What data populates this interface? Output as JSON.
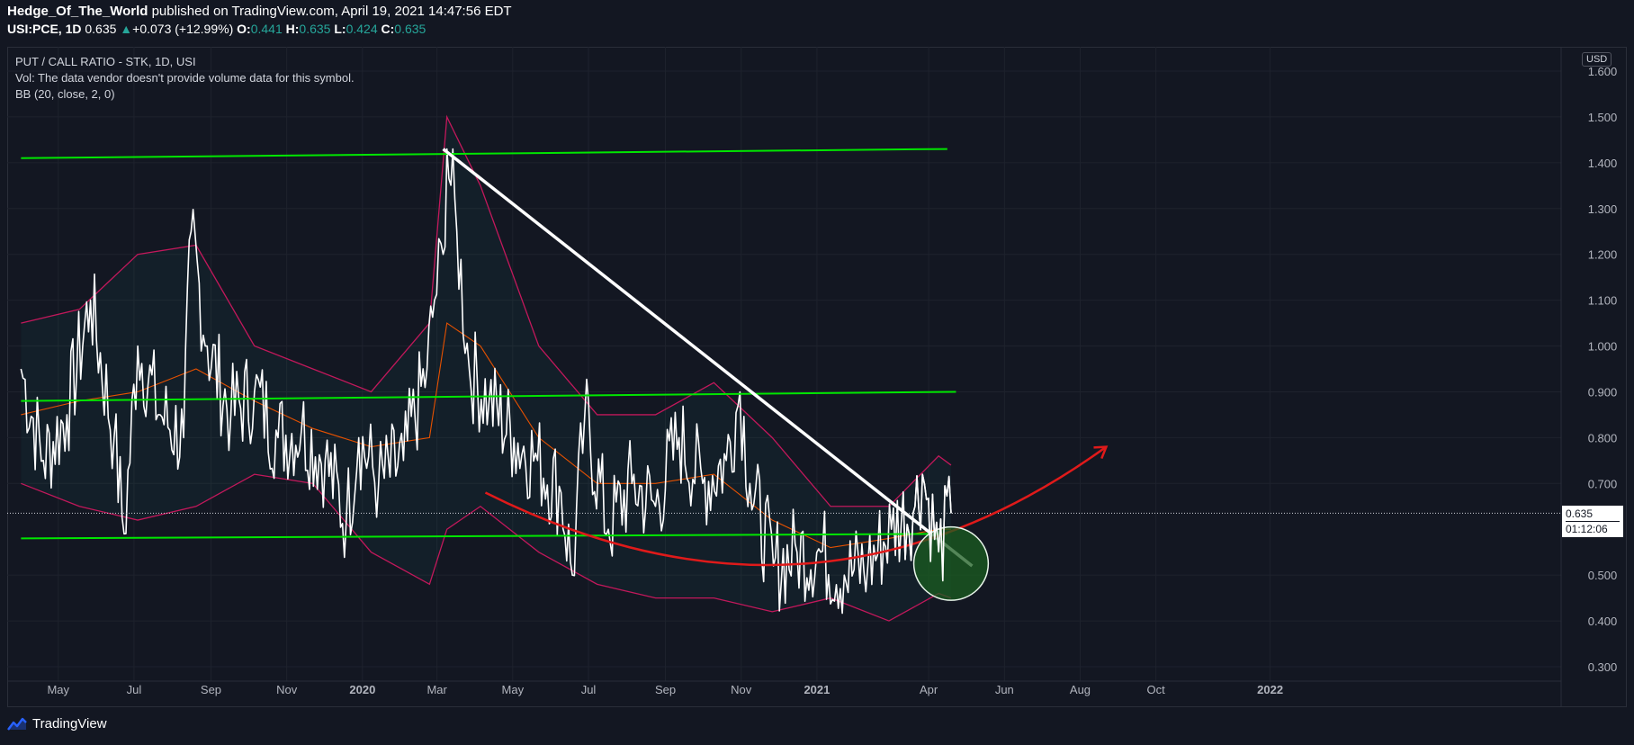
{
  "header": {
    "author": "Hedge_Of_The_World",
    "published": "published on TradingView.com, April 19, 2021 14:47:56 EDT",
    "symbol": "USI:PCE, 1D",
    "last": "0.635",
    "arrow": "▲",
    "change": "+0.073 (+12.99%)",
    "o_label": "O:",
    "o_val": "0.441",
    "h_label": "H:",
    "h_val": "0.635",
    "l_label": "L:",
    "l_val": "0.424",
    "c_label": "C:",
    "c_val": "0.635"
  },
  "legend": {
    "title": "PUT / CALL RATIO - STK, 1D, USI",
    "vol": "Vol: The data vendor doesn't provide volume data for this symbol.",
    "bb": "BB (20, close, 2, 0)"
  },
  "currency": "USD",
  "price_label": {
    "value": "0.635",
    "countdown": "01:12:06"
  },
  "footer": {
    "brand": "TradingView"
  },
  "colors": {
    "bg": "#131722",
    "grid": "#1e222d",
    "price": "#ffffff",
    "band": "#c2185b",
    "basis": "#e65100",
    "channel": "#00e600",
    "trend": "#ffffff",
    "arc": "#e01a1a",
    "circle_fill": "#1b5e20",
    "up": "#26a69a"
  },
  "chart_data": {
    "type": "line",
    "x_ticks": [
      "May",
      "Jul",
      "Sep",
      "Nov",
      "2020",
      "Mar",
      "May",
      "Jul",
      "Sep",
      "Nov",
      "2021",
      "Apr",
      "Jun",
      "Aug",
      "Oct",
      "2022"
    ],
    "y_ticks": [
      "1.600",
      "1.500",
      "1.400",
      "1.300",
      "1.200",
      "1.100",
      "1.000",
      "0.900",
      "0.800",
      "0.700",
      "0.500",
      "0.400",
      "0.300"
    ],
    "ylim": [
      0.27,
      1.63
    ],
    "scale": {
      "t0": "2019-04-08",
      "day_px": 1.38
    },
    "series": [
      {
        "name": "PUT / CALL RATIO - STK",
        "dates": [
          "2019-04-01",
          "2019-04-19",
          "2019-05-08",
          "2019-05-27",
          "2019-06-15",
          "2019-06-23",
          "2019-07-04",
          "2019-07-22",
          "2019-08-10",
          "2019-08-16",
          "2019-08-29",
          "2019-09-17",
          "2019-10-06",
          "2019-10-25",
          "2019-11-13",
          "2019-12-02",
          "2019-12-19",
          "2019-12-29",
          "2020-01-14",
          "2020-02-03",
          "2020-02-22",
          "2020-02-28",
          "2020-03-06",
          "2020-03-09",
          "2020-03-17",
          "2020-03-27",
          "2020-04-12",
          "2020-05-02",
          "2020-05-21",
          "2020-06-09",
          "2020-06-18",
          "2020-06-28",
          "2020-07-17",
          "2020-08-05",
          "2020-08-24",
          "2020-09-12",
          "2020-10-01",
          "2020-10-20",
          "2020-10-31",
          "2020-11-08",
          "2020-11-27",
          "2020-12-16",
          "2021-01-04",
          "2021-01-23",
          "2021-02-11",
          "2021-03-02",
          "2021-03-21",
          "2021-03-27",
          "2021-04-09",
          "2021-04-19"
        ],
        "values": [
          0.95,
          0.75,
          0.85,
          1.1,
          0.8,
          0.59,
          1.0,
          0.85,
          0.8,
          1.25,
          1.0,
          0.85,
          0.9,
          0.8,
          0.82,
          0.75,
          0.62,
          0.8,
          0.7,
          0.75,
          0.95,
          1.1,
          1.2,
          1.43,
          1.25,
          0.95,
          0.88,
          0.8,
          0.75,
          0.68,
          0.5,
          0.85,
          0.6,
          0.7,
          0.65,
          0.8,
          0.7,
          0.75,
          0.9,
          0.7,
          0.52,
          0.55,
          0.55,
          0.5,
          0.52,
          0.6,
          0.65,
          0.72,
          0.55,
          0.635
        ]
      },
      {
        "name": "BB Upper",
        "dates": [
          "2019-04-01",
          "2019-05-18",
          "2019-07-04",
          "2019-08-20",
          "2019-10-06",
          "2019-11-22",
          "2020-01-08",
          "2020-02-24",
          "2020-03-09",
          "2020-04-05",
          "2020-05-22",
          "2020-07-08",
          "2020-08-24",
          "2020-10-10",
          "2020-11-26",
          "2021-01-12",
          "2021-02-28",
          "2021-04-09",
          "2021-04-19"
        ],
        "values": [
          1.05,
          1.08,
          1.2,
          1.22,
          1.0,
          0.95,
          0.9,
          1.05,
          1.5,
          1.35,
          1.0,
          0.85,
          0.85,
          0.92,
          0.8,
          0.65,
          0.65,
          0.76,
          0.74
        ]
      },
      {
        "name": "BB Basis",
        "dates": [
          "2019-04-01",
          "2019-05-18",
          "2019-07-04",
          "2019-08-20",
          "2019-10-06",
          "2019-11-22",
          "2020-01-08",
          "2020-02-24",
          "2020-03-09",
          "2020-04-05",
          "2020-05-22",
          "2020-07-08",
          "2020-08-24",
          "2020-10-10",
          "2020-11-26",
          "2021-01-12",
          "2021-02-28",
          "2021-04-09",
          "2021-04-19"
        ],
        "values": [
          0.85,
          0.88,
          0.9,
          0.95,
          0.88,
          0.82,
          0.78,
          0.8,
          1.05,
          1.0,
          0.8,
          0.7,
          0.7,
          0.72,
          0.62,
          0.56,
          0.58,
          0.6,
          0.6
        ]
      },
      {
        "name": "BB Lower",
        "dates": [
          "2019-04-01",
          "2019-05-18",
          "2019-07-04",
          "2019-08-20",
          "2019-10-06",
          "2019-11-22",
          "2020-01-08",
          "2020-02-24",
          "2020-03-09",
          "2020-04-05",
          "2020-05-22",
          "2020-07-08",
          "2020-08-24",
          "2020-10-10",
          "2020-11-26",
          "2021-01-12",
          "2021-02-28",
          "2021-04-09",
          "2021-04-19"
        ],
        "values": [
          0.7,
          0.65,
          0.62,
          0.65,
          0.72,
          0.7,
          0.55,
          0.48,
          0.6,
          0.65,
          0.55,
          0.48,
          0.45,
          0.45,
          0.42,
          0.45,
          0.4,
          0.46,
          0.45
        ]
      }
    ],
    "annotations": [
      {
        "type": "channel",
        "from": [
          "2019-04-01",
          1.41
        ],
        "to": [
          "2021-04-16",
          1.43
        ]
      },
      {
        "type": "channel",
        "from": [
          "2019-04-01",
          0.88
        ],
        "to": [
          "2021-04-23",
          0.9
        ]
      },
      {
        "type": "channel",
        "from": [
          "2019-04-01",
          0.58
        ],
        "to": [
          "2021-04-16",
          0.59
        ]
      },
      {
        "type": "trendline",
        "from": [
          "2020-03-06",
          1.43
        ],
        "to": [
          "2021-05-06",
          0.52
        ]
      },
      {
        "type": "curve",
        "from": [
          "2020-04-09",
          0.68
        ],
        "via": [
          "2020-12-30",
          0.32
        ],
        "to": [
          "2021-08-22",
          0.78
        ]
      },
      {
        "type": "ellipse",
        "center": [
          "2021-04-19",
          0.525
        ],
        "radius_days": 30,
        "radius_value": 0.08
      }
    ],
    "grid": true,
    "last_value": 0.635
  }
}
